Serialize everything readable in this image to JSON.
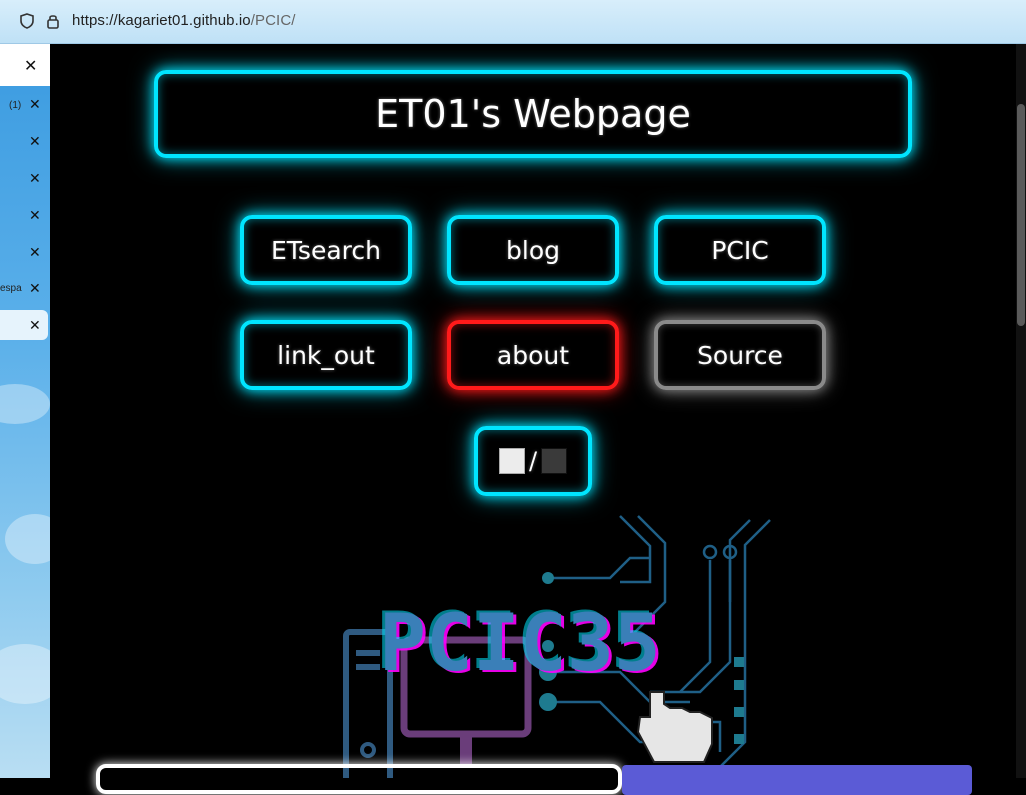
{
  "browser": {
    "url_host": "https://kagariet01.github.io",
    "url_path": "/PCIC/",
    "icons": [
      "shield-icon",
      "lock-icon"
    ]
  },
  "sidebar": {
    "top_close_icon": "close-icon",
    "tabs": [
      {
        "label": "(1)"
      },
      {
        "label": ""
      },
      {
        "label": ""
      },
      {
        "label": ""
      },
      {
        "label": ""
      },
      {
        "label": "espa"
      },
      {
        "label": ""
      }
    ]
  },
  "page": {
    "title": "ET01's Webpage",
    "nav": {
      "row1": [
        "ETsearch",
        "blog",
        "PCIC"
      ],
      "row2": [
        "link_out",
        "about",
        "Source"
      ]
    },
    "theme_toggle_sep": "/",
    "banner_text": "PCIC35"
  },
  "colors": {
    "neon_cyan": "#00e5ff",
    "neon_red": "#ff1a1a",
    "neon_gray": "#8a8a8a",
    "bottom_button": "#5b5bd6"
  }
}
